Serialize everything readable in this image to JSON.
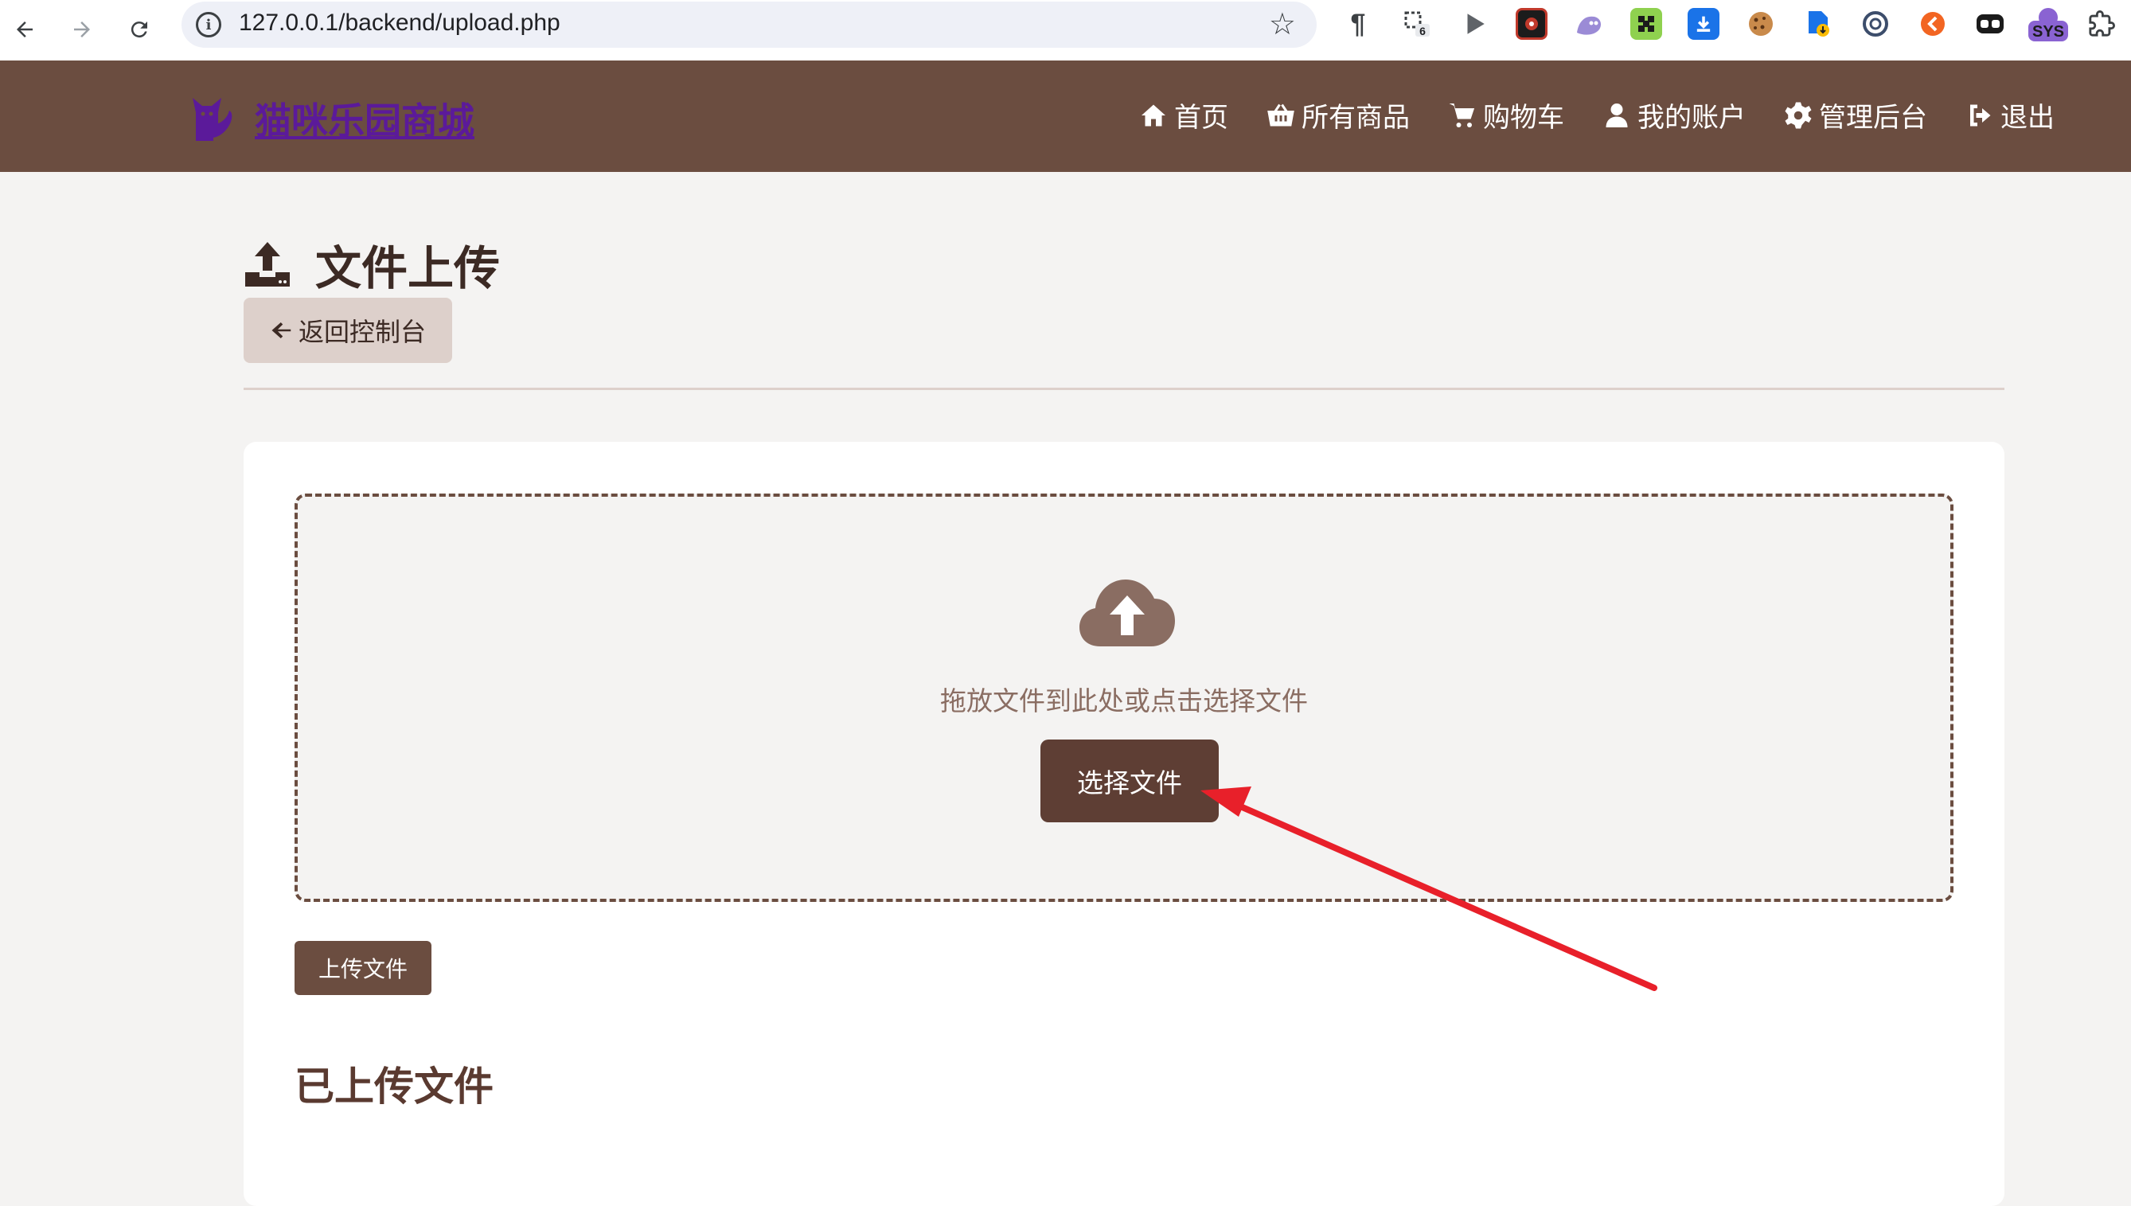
{
  "browser": {
    "url": "127.0.0.1/backend/upload.php",
    "extension_badge": "6",
    "extension_sys_label": "SYS"
  },
  "header": {
    "brand": "猫咪乐园商城",
    "menu": [
      {
        "label": "首页",
        "icon": "home-icon"
      },
      {
        "label": "所有商品",
        "icon": "basket-icon"
      },
      {
        "label": "购物车",
        "icon": "cart-icon"
      },
      {
        "label": "我的账户",
        "icon": "user-icon"
      },
      {
        "label": "管理后台",
        "icon": "gear-icon"
      },
      {
        "label": "退出",
        "icon": "sign-out-icon"
      }
    ]
  },
  "page": {
    "title": "文件上传",
    "back_label": "返回控制台",
    "drop_text": "拖放文件到此处或点击选择文件",
    "choose_label": "选择文件",
    "upload_label": "上传文件",
    "uploaded_title": "已上传文件"
  },
  "colors": {
    "header_bg": "#6b4d40",
    "brand_link": "#5b1a9a",
    "primary_button": "#5e3e34",
    "annotation_arrow": "#e8202a"
  }
}
